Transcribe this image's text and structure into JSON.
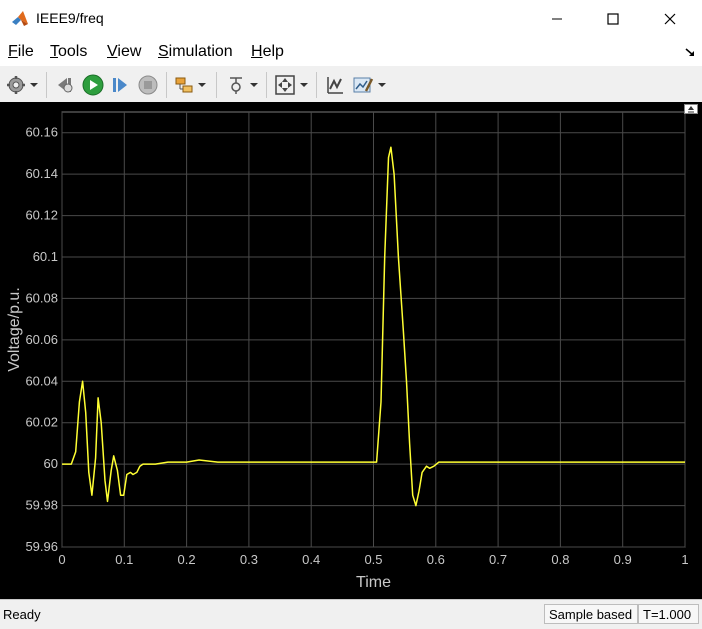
{
  "window": {
    "title": "IEEE9/freq",
    "controls": [
      "minimize",
      "maximize",
      "close"
    ]
  },
  "menu": {
    "items": [
      "File",
      "Tools",
      "View",
      "Simulation",
      "Help"
    ]
  },
  "toolbar": {
    "buttons": [
      "gear-icon",
      "step-back-icon",
      "run-icon",
      "step-forward-icon",
      "stop-icon",
      "highlight-icon",
      "signal-selector-icon",
      "zoom-fit-icon",
      "autoscale-icon",
      "style-icon"
    ]
  },
  "chart_data": {
    "type": "line",
    "title": "",
    "xlabel": "Time",
    "ylabel": "Voltage/p.u.",
    "xlim": [
      0,
      1
    ],
    "ylim": [
      59.96,
      60.17
    ],
    "grid": true,
    "x_ticks": [
      "0",
      "0.1",
      "0.2",
      "0.3",
      "0.4",
      "0.5",
      "0.6",
      "0.7",
      "0.8",
      "0.9",
      "1"
    ],
    "y_ticks": [
      "59.96",
      "59.98",
      "60",
      "60.02",
      "60.04",
      "60.06",
      "60.08",
      "60.1",
      "60.12",
      "60.14",
      "60.16"
    ],
    "colors": {
      "background": "#000000",
      "grid": "#4a4a4a",
      "line": "#ffff33",
      "tick_text": "#c8c8c8"
    },
    "series": [
      {
        "x": [
          0,
          0.015,
          0.022,
          0.028,
          0.033,
          0.038,
          0.043,
          0.048,
          0.054,
          0.058,
          0.063,
          0.069,
          0.073,
          0.079,
          0.083,
          0.089,
          0.094,
          0.099,
          0.104,
          0.11,
          0.114,
          0.12,
          0.125,
          0.13,
          0.14,
          0.15,
          0.17,
          0.2,
          0.22,
          0.25,
          0.3,
          0.35,
          0.4,
          0.45,
          0.5,
          0.505,
          0.512,
          0.518,
          0.524,
          0.528,
          0.533,
          0.54,
          0.548,
          0.553,
          0.558,
          0.563,
          0.568,
          0.573,
          0.578,
          0.585,
          0.59,
          0.597,
          0.605,
          0.62,
          0.65,
          0.7,
          0.8,
          0.9,
          1.0
        ],
        "y": [
          60.0,
          60.0,
          60.006,
          60.03,
          60.04,
          60.025,
          59.996,
          59.985,
          60.003,
          60.032,
          60.02,
          59.992,
          59.982,
          59.997,
          60.004,
          59.997,
          59.985,
          59.985,
          59.995,
          59.996,
          59.995,
          59.996,
          59.999,
          60.0,
          60.0,
          60.0,
          60.001,
          60.001,
          60.002,
          60.001,
          60.001,
          60.001,
          60.001,
          60.001,
          60.001,
          60.001,
          60.03,
          60.1,
          60.148,
          60.153,
          60.14,
          60.1,
          60.064,
          60.04,
          60.01,
          59.985,
          59.98,
          59.987,
          59.996,
          59.999,
          59.998,
          59.999,
          60.001,
          60.001,
          60.001,
          60.001,
          60.001,
          60.001,
          60.001
        ]
      }
    ]
  },
  "status": {
    "ready": "Ready",
    "sample_mode": "Sample based",
    "time": "T=1.000"
  }
}
